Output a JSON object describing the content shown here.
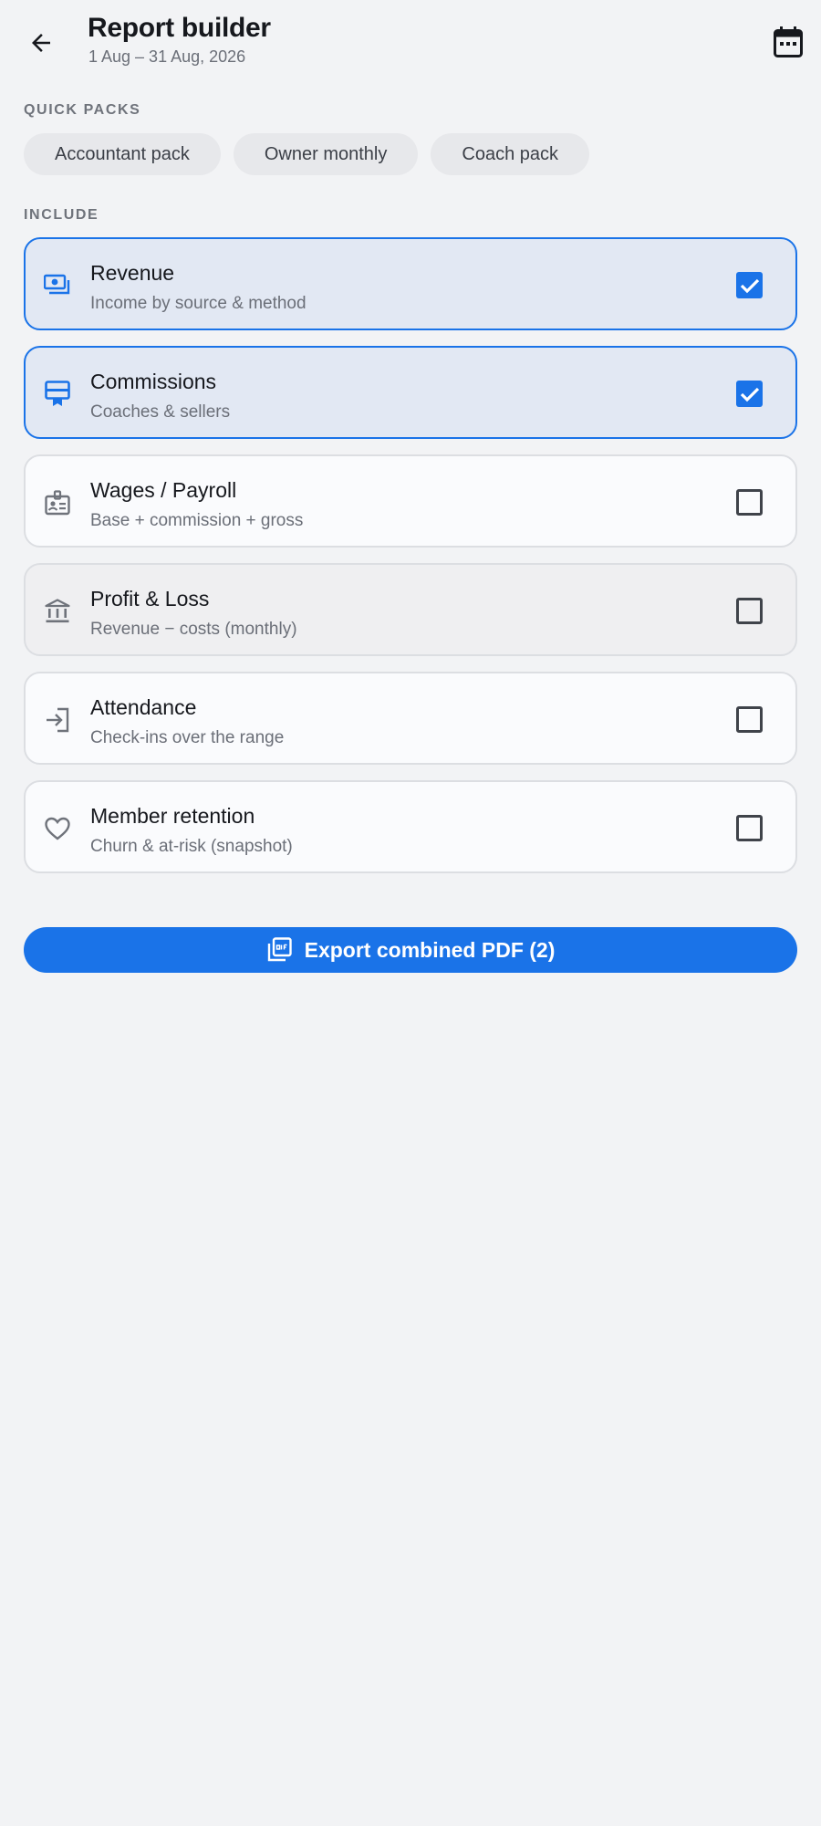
{
  "header": {
    "title": "Report builder",
    "date_range": "1 Aug – 31 Aug, 2026"
  },
  "quick_packs": {
    "label": "QUICK PACKS",
    "chips": [
      "Accountant pack",
      "Owner monthly",
      "Coach pack"
    ]
  },
  "include": {
    "label": "INCLUDE",
    "items": [
      {
        "title": "Revenue",
        "subtitle": "Income by source & method",
        "checked": true,
        "icon": "payments-icon"
      },
      {
        "title": "Commissions",
        "subtitle": "Coaches & sellers",
        "checked": true,
        "icon": "card-membership-icon"
      },
      {
        "title": "Wages / Payroll",
        "subtitle": "Base + commission + gross",
        "checked": false,
        "icon": "badge-icon"
      },
      {
        "title": "Profit & Loss",
        "subtitle": "Revenue − costs (monthly)",
        "checked": false,
        "icon": "bank-icon"
      },
      {
        "title": "Attendance",
        "subtitle": "Check-ins over the range",
        "checked": false,
        "icon": "login-icon"
      },
      {
        "title": "Member retention",
        "subtitle": "Churn & at-risk (snapshot)",
        "checked": false,
        "icon": "heart-icon"
      }
    ]
  },
  "export_button": {
    "label": "Export combined PDF (2)",
    "icon": "pdf-stack-icon"
  },
  "colors": {
    "accent": "#1a73e8",
    "background": "#f2f3f5",
    "selected_card_bg": "#e2e8f3"
  }
}
